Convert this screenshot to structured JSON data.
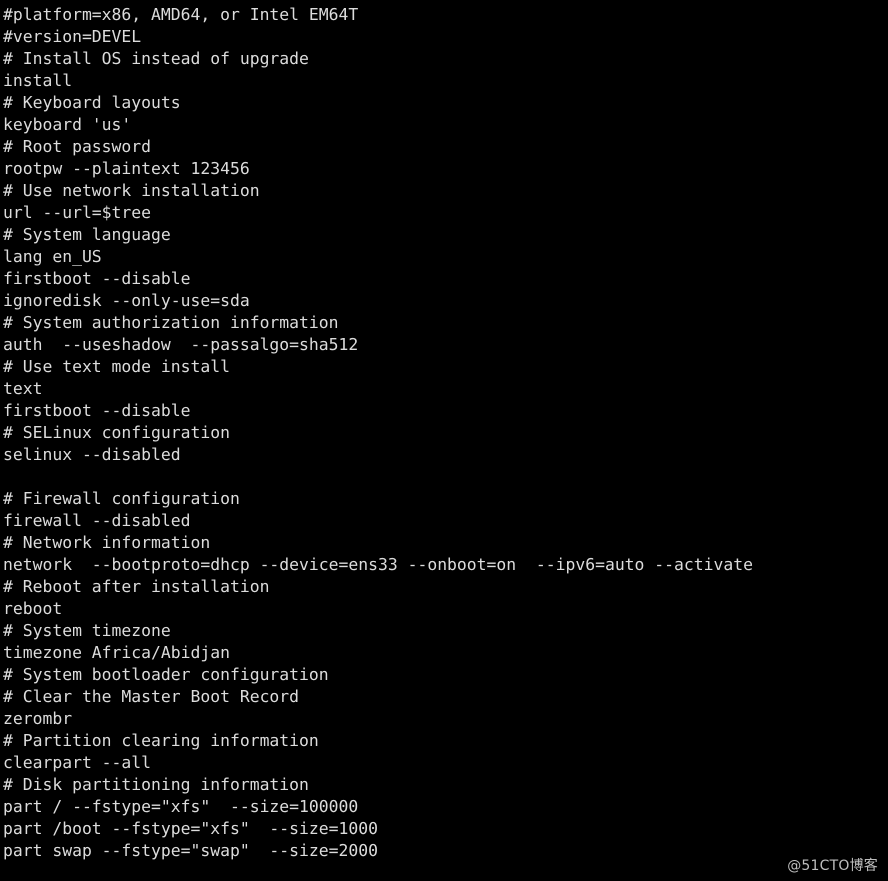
{
  "terminal": {
    "background_color": "#000000",
    "text_color": "#dcdcdc",
    "lines": [
      "#platform=x86, AMD64, or Intel EM64T",
      "#version=DEVEL",
      "# Install OS instead of upgrade",
      "install",
      "# Keyboard layouts",
      "keyboard 'us'",
      "# Root password",
      "rootpw --plaintext 123456",
      "# Use network installation",
      "url --url=$tree",
      "# System language",
      "lang en_US",
      "firstboot --disable",
      "ignoredisk --only-use=sda",
      "# System authorization information",
      "auth  --useshadow  --passalgo=sha512",
      "# Use text mode install",
      "text",
      "firstboot --disable",
      "# SELinux configuration",
      "selinux --disabled",
      "",
      "# Firewall configuration",
      "firewall --disabled",
      "# Network information",
      "network  --bootproto=dhcp --device=ens33 --onboot=on  --ipv6=auto --activate",
      "# Reboot after installation",
      "reboot",
      "# System timezone",
      "timezone Africa/Abidjan",
      "# System bootloader configuration",
      "# Clear the Master Boot Record",
      "zerombr",
      "# Partition clearing information",
      "clearpart --all",
      "# Disk partitioning information",
      "part / --fstype=\"xfs\"  --size=100000",
      "part /boot --fstype=\"xfs\"  --size=1000",
      "part swap --fstype=\"swap\"  --size=2000"
    ]
  },
  "watermark": {
    "text": "@51CTO博客"
  }
}
